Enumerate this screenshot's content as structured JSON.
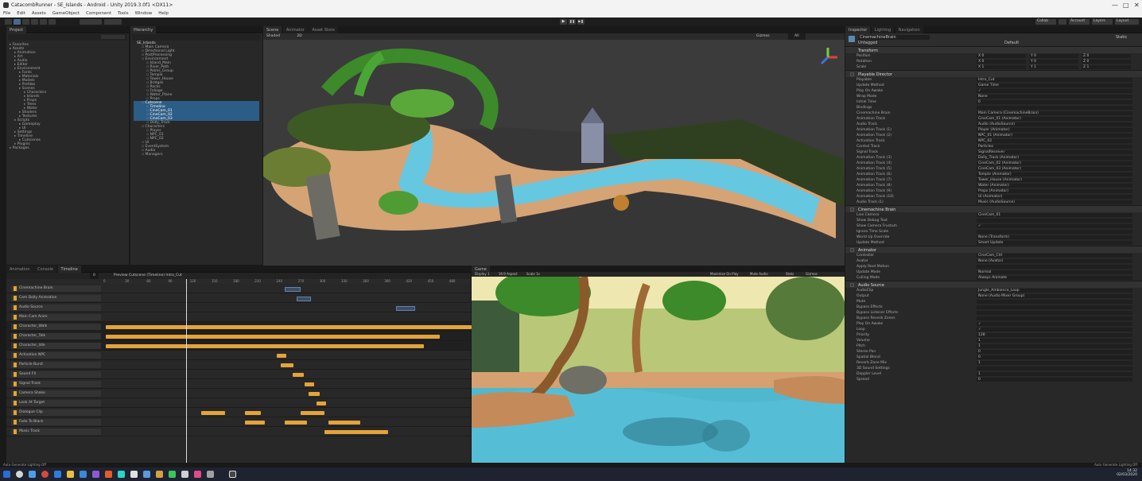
{
  "window": {
    "title": "CatacombRunner - SE_Islands - Android - Unity 2019.3.0f1 <DX11>",
    "controls": [
      "—",
      "□",
      "✕"
    ]
  },
  "menu": [
    "File",
    "Edit",
    "Assets",
    "GameObject",
    "Component",
    "Tools",
    "Window",
    "Help"
  ],
  "toolbar": {
    "play": "▶",
    "pause": "❚❚",
    "step": "▶❚",
    "right": [
      "Collab",
      "Account",
      "Layers",
      "Layout"
    ]
  },
  "project": {
    "tab": "Project",
    "search": "",
    "items": [
      {
        "label": "Favorites",
        "d": 0
      },
      {
        "label": "Assets",
        "d": 0
      },
      {
        "label": "Animation",
        "d": 1
      },
      {
        "label": "Art",
        "d": 1
      },
      {
        "label": "Audio",
        "d": 1
      },
      {
        "label": "Editor",
        "d": 1
      },
      {
        "label": "Environment",
        "d": 1
      },
      {
        "label": "Fonts",
        "d": 2
      },
      {
        "label": "Materials",
        "d": 2
      },
      {
        "label": "Models",
        "d": 2
      },
      {
        "label": "Prefabs",
        "d": 2
      },
      {
        "label": "Scenes",
        "d": 2
      },
      {
        "label": "Characters",
        "d": 3
      },
      {
        "label": "Islands",
        "d": 3
      },
      {
        "label": "Props",
        "d": 3
      },
      {
        "label": "Trees",
        "d": 3
      },
      {
        "label": "Water",
        "d": 3
      },
      {
        "label": "Shaders",
        "d": 2
      },
      {
        "label": "Textures",
        "d": 2
      },
      {
        "label": "Scripts",
        "d": 1
      },
      {
        "label": "Gameplay",
        "d": 2
      },
      {
        "label": "UI",
        "d": 2
      },
      {
        "label": "Settings",
        "d": 1
      },
      {
        "label": "Timeline",
        "d": 1
      },
      {
        "label": "Cutscenes",
        "d": 2
      },
      {
        "label": "Plugins",
        "d": 1
      },
      {
        "label": "Packages",
        "d": 0
      }
    ]
  },
  "hierarchy": {
    "tab": "Hierarchy",
    "scene": "SE_Islands",
    "items": [
      {
        "label": "Main Camera",
        "d": 1
      },
      {
        "label": "Directional Light",
        "d": 1
      },
      {
        "label": "PostProcessing",
        "d": 1
      },
      {
        "label": "Environment",
        "d": 1
      },
      {
        "label": "Island_Main",
        "d": 2
      },
      {
        "label": "River_Path",
        "d": 2
      },
      {
        "label": "Palms_Group",
        "d": 2
      },
      {
        "label": "Temple",
        "d": 2
      },
      {
        "label": "Tower_House",
        "d": 2
      },
      {
        "label": "Bridges",
        "d": 2
      },
      {
        "label": "Rocks",
        "d": 2
      },
      {
        "label": "Foliage",
        "d": 2
      },
      {
        "label": "Water_Plane",
        "d": 2
      },
      {
        "label": "Props",
        "d": 2
      },
      {
        "label": "Cutscene",
        "d": 1,
        "sel": true
      },
      {
        "label": "Timeline",
        "d": 2,
        "sel": true
      },
      {
        "label": "CineCam_01",
        "d": 2,
        "sel": true
      },
      {
        "label": "CineCam_02",
        "d": 2,
        "sel": true
      },
      {
        "label": "CineCam_03",
        "d": 2,
        "sel": true
      },
      {
        "label": "Dolly_Track",
        "d": 2
      },
      {
        "label": "Characters",
        "d": 1
      },
      {
        "label": "Player",
        "d": 2
      },
      {
        "label": "NPC_01",
        "d": 2
      },
      {
        "label": "NPC_02",
        "d": 2
      },
      {
        "label": "UI",
        "d": 1
      },
      {
        "label": "EventSystem",
        "d": 1
      },
      {
        "label": "Audio",
        "d": 1
      },
      {
        "label": "Managers",
        "d": 1
      }
    ]
  },
  "scene_view": {
    "tabs": [
      "Scene",
      "Animator",
      "Asset Store"
    ],
    "shading": "Shaded",
    "mode": "2D",
    "gizmos": "Gizmos",
    "search": "All",
    "persp": "< Persp"
  },
  "timeline": {
    "tabs": [
      "Animation",
      "Console",
      "Timeline"
    ],
    "asset": "Preview   Cutscene (Timeline)   Intro_Cut",
    "frame": "0",
    "ticks": [
      "0",
      "30",
      "60",
      "90",
      "120",
      "150",
      "180",
      "210",
      "240",
      "270",
      "300",
      "330",
      "360",
      "390",
      "420",
      "450",
      "480"
    ],
    "tracks": [
      "Cinemachine Brain",
      "Cam Dolly Animation",
      "Audio Source",
      "Main Cam Anim",
      "Character_Walk",
      "Character_Talk",
      "Character_Idle",
      "Activation NPC",
      "Particle Burst",
      "Sound FX",
      "Signal Track",
      "Camera Shake",
      "Look At Target",
      "Dialogue Clip",
      "Fade To Black",
      "Music Track"
    ]
  },
  "game_view": {
    "tab": "Game",
    "display": "Display 1",
    "aspect": "16:9 Aspect",
    "scale": "Scale 1x",
    "buttons": [
      "Maximize On Play",
      "Mute Audio",
      "Stats",
      "Gizmos"
    ]
  },
  "inspector": {
    "tabs": [
      "Inspector",
      "Lighting",
      "Navigation"
    ],
    "object": "CinemachineBrain",
    "tag": "Untagged",
    "layer": "Default",
    "static": "Static",
    "transform": {
      "name": "Transform",
      "rows": [
        {
          "l": "Position",
          "v": [
            "X 0",
            "Y 0",
            "Z 0"
          ]
        },
        {
          "l": "Rotation",
          "v": [
            "X 0",
            "Y 0",
            "Z 0"
          ]
        },
        {
          "l": "Scale",
          "v": [
            "X 1",
            "Y 1",
            "Z 1"
          ]
        }
      ]
    },
    "director": {
      "name": "Playable Director",
      "rows": [
        {
          "l": "Playable",
          "v": "Intro_Cut"
        },
        {
          "l": "Update Method",
          "v": "Game Time"
        },
        {
          "l": "Play On Awake",
          "v": "✓"
        },
        {
          "l": "Wrap Mode",
          "v": "None"
        },
        {
          "l": "Initial Time",
          "v": "0"
        },
        {
          "l": "Bindings",
          "v": ""
        },
        {
          "l": "Cinemachine Brain",
          "v": "Main Camera (CinemachineBrain)"
        },
        {
          "l": "Animation Track",
          "v": "CineCam_01 (Animator)"
        },
        {
          "l": "Audio Track",
          "v": "Audio (AudioSource)"
        },
        {
          "l": "Animation Track (1)",
          "v": "Player (Animator)"
        },
        {
          "l": "Animation Track (2)",
          "v": "NPC_01 (Animator)"
        },
        {
          "l": "Activation Track",
          "v": "NPC_02"
        },
        {
          "l": "Control Track",
          "v": "Particles"
        },
        {
          "l": "Signal Track",
          "v": "SignalReceiver"
        },
        {
          "l": "Animation Track (3)",
          "v": "Dolly_Track (Animator)"
        },
        {
          "l": "Animation Track (4)",
          "v": "CineCam_02 (Animator)"
        },
        {
          "l": "Animation Track (5)",
          "v": "CineCam_03 (Animator)"
        },
        {
          "l": "Animation Track (6)",
          "v": "Temple (Animator)"
        },
        {
          "l": "Animation Track (7)",
          "v": "Tower_House (Animator)"
        },
        {
          "l": "Animation Track (8)",
          "v": "Water (Animator)"
        },
        {
          "l": "Animation Track (9)",
          "v": "Props (Animator)"
        },
        {
          "l": "Animation Track (10)",
          "v": "UI (Animator)"
        },
        {
          "l": "Audio Track (1)",
          "v": "Music (AudioSource)"
        }
      ]
    },
    "camera": {
      "name": "Cinemachine Brain",
      "rows": [
        {
          "l": "Live Camera",
          "v": "CineCam_01"
        },
        {
          "l": "Show Debug Text",
          "v": ""
        },
        {
          "l": "Show Camera Frustum",
          "v": "✓"
        },
        {
          "l": "Ignore Time Scale",
          "v": ""
        },
        {
          "l": "World Up Override",
          "v": "None (Transform)"
        },
        {
          "l": "Update Method",
          "v": "Smart Update"
        }
      ]
    },
    "follow": {
      "name": "Animator",
      "rows": [
        {
          "l": "Controller",
          "v": "CineCam_Ctrl"
        },
        {
          "l": "Avatar",
          "v": "None (Avatar)"
        },
        {
          "l": "Apply Root Motion",
          "v": ""
        },
        {
          "l": "Update Mode",
          "v": "Normal"
        },
        {
          "l": "Culling Mode",
          "v": "Always Animate"
        }
      ]
    },
    "audio": {
      "name": "Audio Source",
      "rows": [
        {
          "l": "AudioClip",
          "v": "Jungle_Ambience_Loop"
        },
        {
          "l": "Output",
          "v": "None (Audio Mixer Group)"
        },
        {
          "l": "Mute",
          "v": ""
        },
        {
          "l": "Bypass Effects",
          "v": ""
        },
        {
          "l": "Bypass Listener Effects",
          "v": ""
        },
        {
          "l": "Bypass Reverb Zones",
          "v": ""
        },
        {
          "l": "Play On Awake",
          "v": "✓"
        },
        {
          "l": "Loop",
          "v": "✓"
        },
        {
          "l": "Priority",
          "v": "128"
        },
        {
          "l": "Volume",
          "v": "1"
        },
        {
          "l": "Pitch",
          "v": "1"
        },
        {
          "l": "Stereo Pan",
          "v": "0"
        },
        {
          "l": "Spatial Blend",
          "v": "0"
        },
        {
          "l": "Reverb Zone Mix",
          "v": "1"
        },
        {
          "l": "3D Sound Settings",
          "v": ""
        },
        {
          "l": "Doppler Level",
          "v": "1"
        },
        {
          "l": "Spread",
          "v": "0"
        }
      ]
    }
  },
  "status": {
    "left": "Auto Generate Lighting Off",
    "right": "Auto Generate Lighting Off"
  },
  "taskbar": {
    "time": "14:32",
    "date": "02/03/2020"
  }
}
